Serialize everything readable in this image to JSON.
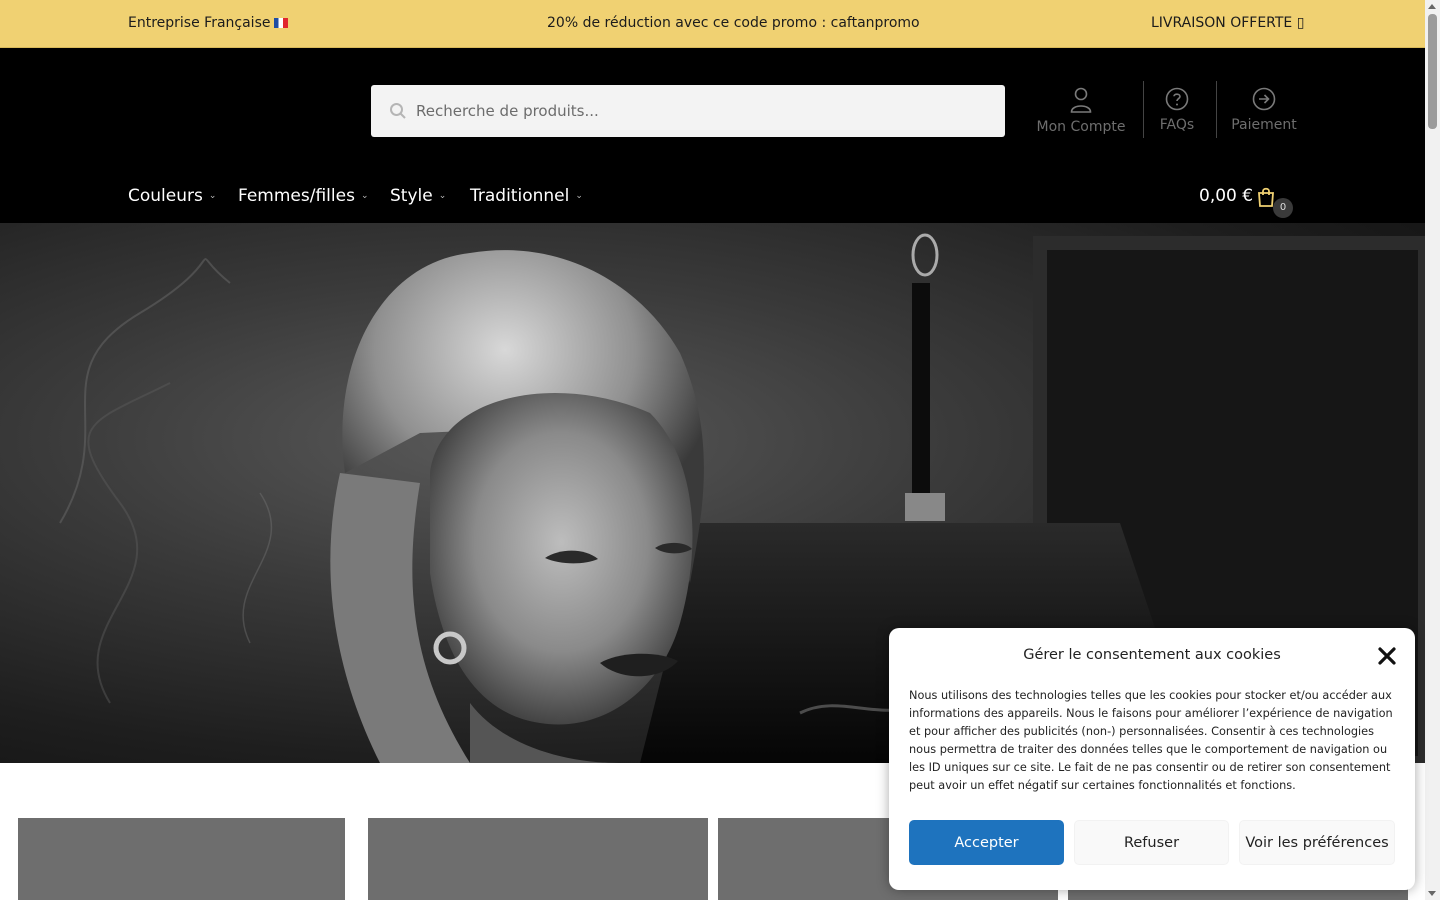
{
  "topbar": {
    "left_text": "Entreprise Française",
    "center_text": "20% de réduction avec ce code promo : caftanpromo",
    "right_text": "LIVRAISON OFFERTE ▯",
    "background": "#f0d172"
  },
  "search": {
    "placeholder": "Recherche de produits..."
  },
  "account_links": [
    {
      "label": "Mon Compte",
      "icon": "user-icon"
    },
    {
      "label": "FAQs",
      "icon": "question-circle-icon"
    },
    {
      "label": "Paiement",
      "icon": "arrow-right-circle-icon"
    }
  ],
  "nav": {
    "items": [
      {
        "label": "Couleurs"
      },
      {
        "label": "Femmes/filles"
      },
      {
        "label": "Style"
      },
      {
        "label": "Traditionnel"
      }
    ]
  },
  "cart": {
    "total": "0,00 €",
    "count": "0",
    "icon": "shopping-bag-icon",
    "accent": "#f0d172"
  },
  "cookie": {
    "title": "Gérer le consentement aux cookies",
    "body": "Nous utilisons des technologies telles que les cookies pour stocker et/ou accéder aux informations des appareils. Nous le faisons pour améliorer l’expérience de navigation et pour afficher des publicités (non-) personnalisées. Consentir à ces technologies nous permettra de traiter des données telles que le comportement de navigation ou les ID uniques sur ce site. Le fait de ne pas consentir ou de retirer son consentement peut avoir un effet négatif sur certaines fonctionnalités et fonctions.",
    "accept_label": "Accepter",
    "refuse_label": "Refuser",
    "prefs_label": "Voir les préférences",
    "accept_color": "#1e73be"
  }
}
